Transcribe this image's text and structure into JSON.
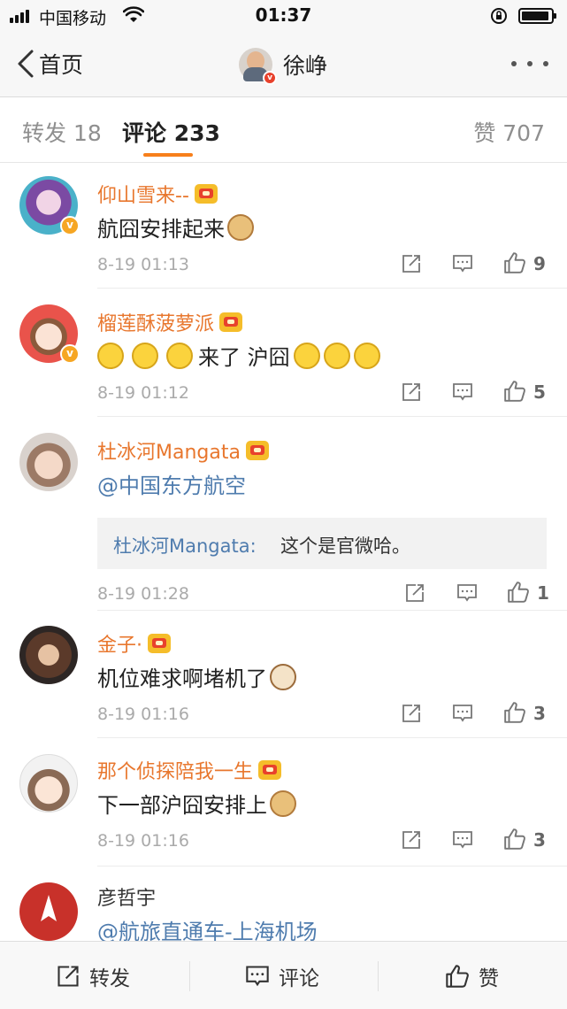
{
  "status_bar": {
    "carrier": "中国移动",
    "time": "01:37"
  },
  "nav": {
    "back_label": "首页",
    "title": "徐峥"
  },
  "tabs": {
    "repost": "转发 18",
    "comment": "评论 233",
    "like": "赞 707"
  },
  "comments": [
    {
      "user": "仰山雪来--",
      "text": "航囧安排起来",
      "time": "8-19 01:13",
      "likes": "9"
    },
    {
      "user": "榴莲酥菠萝派",
      "text_prefix": "",
      "text": "来了 沪囧",
      "time": "8-19 01:12",
      "likes": "5"
    },
    {
      "user": "杜冰河Mangata",
      "text": "@中国东方航空",
      "reply_user": "杜冰河Mangata:",
      "reply_text": "这个是官微哈。",
      "time": "8-19 01:28",
      "likes": "1"
    },
    {
      "user": "金子·",
      "text": "机位难求啊堵机了",
      "time": "8-19 01:16",
      "likes": "3"
    },
    {
      "user": "那个侦探陪我一生",
      "text": "下一部沪囧安排上",
      "time": "8-19 01:16",
      "likes": "3"
    },
    {
      "user": "彦哲宇",
      "text": "@航旅直通车-上海机场"
    }
  ],
  "bottom_bar": {
    "repost": "转发",
    "comment": "评论",
    "like": "赞"
  },
  "colors": {
    "username": "#e8772e",
    "link": "#4f7cae",
    "tab_underline": "#f77f1b",
    "verified_badge": "#f6a623"
  },
  "icons": [
    "back-chevron-icon",
    "more-icon",
    "repost-icon",
    "comment-icon",
    "like-icon",
    "crown-badge-icon",
    "verified-badge-icon"
  ]
}
